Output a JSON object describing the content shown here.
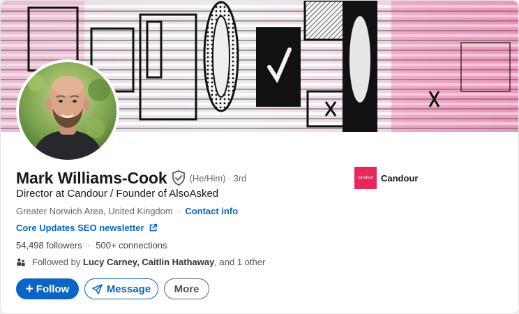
{
  "profile": {
    "name": "Mark Williams-Cook",
    "pronouns": "(He/Him)",
    "degree": "· 3rd",
    "headline": "Director at Candour / Founder of AlsoAsked",
    "location": "Greater Norwich Area, United Kingdom",
    "location_sep": "·",
    "contact_info_label": "Contact info",
    "newsletter_label": "Core Updates SEO newsletter",
    "followers": "54,498 followers",
    "stats_sep": "·",
    "connections": "500+ connections",
    "followed_by_prefix": "Followed by",
    "followed_by_names": "Lucy Carney, Caitlin Hathaway",
    "followed_by_suffix": ", and 1 other"
  },
  "actions": {
    "follow_label": "Follow",
    "message_label": "Message",
    "more_label": "More"
  },
  "company": {
    "logo_text": "candour",
    "name": "Candour"
  },
  "colors": {
    "link_blue": "#0a66c2",
    "candour_pink": "#e9275a"
  },
  "icons": {
    "verified": "verified-shield-icon",
    "external": "external-link-icon",
    "people": "people-icon",
    "send": "send-icon",
    "plus": "plus-icon"
  }
}
